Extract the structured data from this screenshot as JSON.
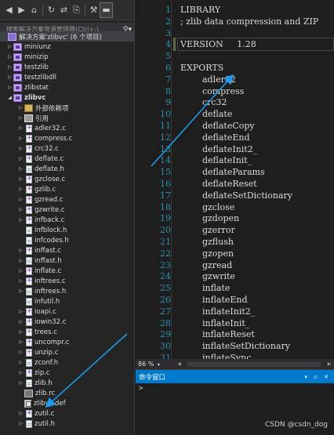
{
  "toolbar": {
    "icons": [
      "back-icon",
      "forward-icon",
      "home-icon",
      "history-icon",
      "sync-icon",
      "copy-icon",
      "wrench-icon",
      "pin-icon"
    ],
    "glyphs": [
      "◀",
      "▶",
      "⌂",
      "↻",
      "⇄",
      "⎘",
      "🔧",
      "▬"
    ]
  },
  "search": {
    "placeholder": "搜索解决方案资源管理器(Ctrl+;)",
    "icon": "search-icon"
  },
  "tree": [
    {
      "label": "解决方案'zlibvc' (6 个项目)",
      "level": 0,
      "arrow": "none",
      "icon": "sln",
      "selected": true
    },
    {
      "label": "miniunz",
      "level": 0,
      "arrow": "closed",
      "icon": "proj"
    },
    {
      "label": "minizip",
      "level": 0,
      "arrow": "closed",
      "icon": "proj"
    },
    {
      "label": "testzlib",
      "level": 0,
      "arrow": "closed",
      "icon": "proj"
    },
    {
      "label": "testzlibdll",
      "level": 0,
      "arrow": "closed",
      "icon": "proj"
    },
    {
      "label": "zlibstat",
      "level": 0,
      "arrow": "closed",
      "icon": "proj"
    },
    {
      "label": "zlibvc",
      "level": 0,
      "arrow": "open",
      "icon": "proj",
      "bold": true
    },
    {
      "label": "外部依赖项",
      "level": 1,
      "arrow": "closed",
      "icon": "deps"
    },
    {
      "label": "引用",
      "level": 1,
      "arrow": "closed",
      "icon": "refs"
    },
    {
      "label": "adler32.c",
      "level": 1,
      "arrow": "closed",
      "icon": "cpp"
    },
    {
      "label": "compress.c",
      "level": 1,
      "arrow": "closed",
      "icon": "cpp"
    },
    {
      "label": "crc32.c",
      "level": 1,
      "arrow": "closed",
      "icon": "cpp"
    },
    {
      "label": "deflate.c",
      "level": 1,
      "arrow": "closed",
      "icon": "cpp"
    },
    {
      "label": "deflate.h",
      "level": 1,
      "arrow": "closed",
      "icon": "file"
    },
    {
      "label": "gzclose.c",
      "level": 1,
      "arrow": "closed",
      "icon": "cpp"
    },
    {
      "label": "gzlib.c",
      "level": 1,
      "arrow": "closed",
      "icon": "cpp"
    },
    {
      "label": "gzread.c",
      "level": 1,
      "arrow": "closed",
      "icon": "cpp"
    },
    {
      "label": "gzwrite.c",
      "level": 1,
      "arrow": "closed",
      "icon": "cpp"
    },
    {
      "label": "infback.c",
      "level": 1,
      "arrow": "closed",
      "icon": "cpp"
    },
    {
      "label": "infblock.h",
      "level": 1,
      "arrow": "none",
      "icon": "file"
    },
    {
      "label": "infcodes.h",
      "level": 1,
      "arrow": "none",
      "icon": "file"
    },
    {
      "label": "inffast.c",
      "level": 1,
      "arrow": "closed",
      "icon": "cpp"
    },
    {
      "label": "inffast.h",
      "level": 1,
      "arrow": "closed",
      "icon": "file"
    },
    {
      "label": "inflate.c",
      "level": 1,
      "arrow": "closed",
      "icon": "cpp"
    },
    {
      "label": "inftrees.c",
      "level": 1,
      "arrow": "closed",
      "icon": "cpp"
    },
    {
      "label": "inftrees.h",
      "level": 1,
      "arrow": "closed",
      "icon": "file"
    },
    {
      "label": "infutil.h",
      "level": 1,
      "arrow": "none",
      "icon": "file"
    },
    {
      "label": "ioapi.c",
      "level": 1,
      "arrow": "closed",
      "icon": "cpp"
    },
    {
      "label": "iowin32.c",
      "level": 1,
      "arrow": "closed",
      "icon": "cpp"
    },
    {
      "label": "trees.c",
      "level": 1,
      "arrow": "closed",
      "icon": "cpp"
    },
    {
      "label": "uncompr.c",
      "level": 1,
      "arrow": "closed",
      "icon": "cpp"
    },
    {
      "label": "unzip.c",
      "level": 1,
      "arrow": "closed",
      "icon": "cpp"
    },
    {
      "label": "zconf.h",
      "level": 1,
      "arrow": "closed",
      "icon": "file"
    },
    {
      "label": "zip.c",
      "level": 1,
      "arrow": "closed",
      "icon": "cpp"
    },
    {
      "label": "zlib.h",
      "level": 1,
      "arrow": "closed",
      "icon": "file"
    },
    {
      "label": "zlib.rc",
      "level": 1,
      "arrow": "none",
      "icon": "rc"
    },
    {
      "label": "zlibvc.def",
      "level": 1,
      "arrow": "none",
      "icon": "def"
    },
    {
      "label": "zutil.c",
      "level": 1,
      "arrow": "closed",
      "icon": "cpp"
    },
    {
      "label": "zutil.h",
      "level": 1,
      "arrow": "closed",
      "icon": "file"
    }
  ],
  "editor": {
    "current_line": 4,
    "lines": [
      {
        "n": "1",
        "text": "LIBRARY"
      },
      {
        "n": "2",
        "text": "; zlib data compression and ZIP"
      },
      {
        "n": "3",
        "text": ""
      },
      {
        "n": "4",
        "text": "VERSION     1.28"
      },
      {
        "n": "5",
        "text": ""
      },
      {
        "n": "6",
        "text": "EXPORTS"
      },
      {
        "n": "7",
        "text": "        adler32"
      },
      {
        "n": "8",
        "text": "        compress"
      },
      {
        "n": "9",
        "text": "        crc32"
      },
      {
        "n": "10",
        "text": "        deflate"
      },
      {
        "n": "11",
        "text": "        deflateCopy"
      },
      {
        "n": "12",
        "text": "        deflateEnd"
      },
      {
        "n": "13",
        "text": "        deflateInit2_"
      },
      {
        "n": "14",
        "text": "        deflateInit_"
      },
      {
        "n": "15",
        "text": "        deflateParams"
      },
      {
        "n": "16",
        "text": "        deflateReset"
      },
      {
        "n": "17",
        "text": "        deflateSetDictionary"
      },
      {
        "n": "18",
        "text": "        gzclose"
      },
      {
        "n": "19",
        "text": "        gzdopen"
      },
      {
        "n": "20",
        "text": "        gzerror"
      },
      {
        "n": "21",
        "text": "        gzflush"
      },
      {
        "n": "22",
        "text": "        gzopen"
      },
      {
        "n": "23",
        "text": "        gzread"
      },
      {
        "n": "24",
        "text": "        gzwrite"
      },
      {
        "n": "25",
        "text": "        inflate"
      },
      {
        "n": "26",
        "text": "        inflateEnd"
      },
      {
        "n": "27",
        "text": "        inflateInit2_"
      },
      {
        "n": "28",
        "text": "        inflateInit_"
      },
      {
        "n": "29",
        "text": "        inflateReset"
      },
      {
        "n": "30",
        "text": "        inflateSetDictionary"
      },
      {
        "n": "31",
        "text": "        inflateSync"
      }
    ]
  },
  "zoom": {
    "value": "86 %",
    "dropdown_glyph": "▾"
  },
  "command_window": {
    "title": "命令窗口",
    "prompt": ">",
    "buttons": "▾ ▫ ✕"
  },
  "watermark": "CSDN @csdn_dog",
  "colors": {
    "annotation_arrow": "#1e9be8",
    "title_bar": "#007acc",
    "line_number": "#2b91af"
  }
}
